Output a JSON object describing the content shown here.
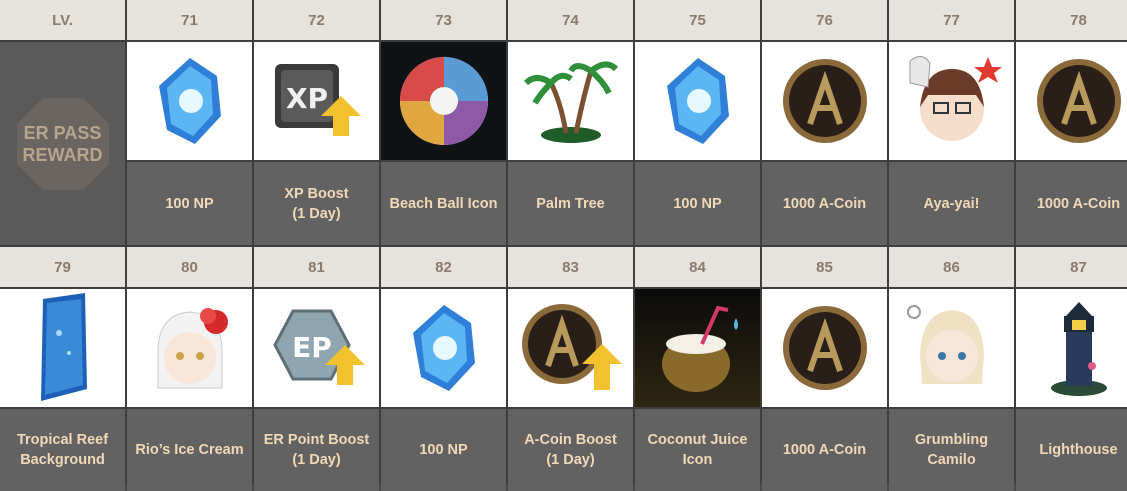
{
  "header_label": "LV.",
  "badge_text": "ER PASS\nREWARD",
  "rows": [
    {
      "levels": [
        "71",
        "72",
        "73",
        "74",
        "75",
        "76",
        "77",
        "78"
      ],
      "names": [
        "100 NP",
        "XP Boost\n(1 Day)",
        "Beach Ball Icon",
        "Palm Tree",
        "100 NP",
        "1000 A-Coin",
        "Aya-yai!",
        "1000 A-Coin"
      ],
      "icons": [
        "np-crystal-icon",
        "xp-boost-icon",
        "beach-ball-icon",
        "palm-tree-icon",
        "np-crystal-icon",
        "a-coin-icon",
        "aya-yai-emote-icon",
        "a-coin-icon"
      ]
    },
    {
      "levels": [
        "79",
        "80",
        "81",
        "82",
        "83",
        "84",
        "85",
        "86",
        "87"
      ],
      "names": [
        "Tropical Reef\nBackground",
        "Rio’s Ice Cream",
        "ER Point Boost\n(1 Day)",
        "100 NP",
        "A-Coin Boost\n(1 Day)",
        "Coconut Juice\nIcon",
        "1000 A-Coin",
        "Grumbling\nCamilo",
        "Lighthouse"
      ],
      "icons": [
        "tropical-reef-icon",
        "rio-ice-cream-emote-icon",
        "ep-boost-icon",
        "np-crystal-icon",
        "a-coin-boost-icon",
        "coconut-juice-icon",
        "a-coin-icon",
        "grumbling-camilo-emote-icon",
        "lighthouse-icon"
      ]
    }
  ],
  "colors": {
    "header_bg": "#e6e2dd",
    "header_text": "#8a7b6b",
    "name_bg": "#626262",
    "name_text": "#f0d9b8"
  }
}
